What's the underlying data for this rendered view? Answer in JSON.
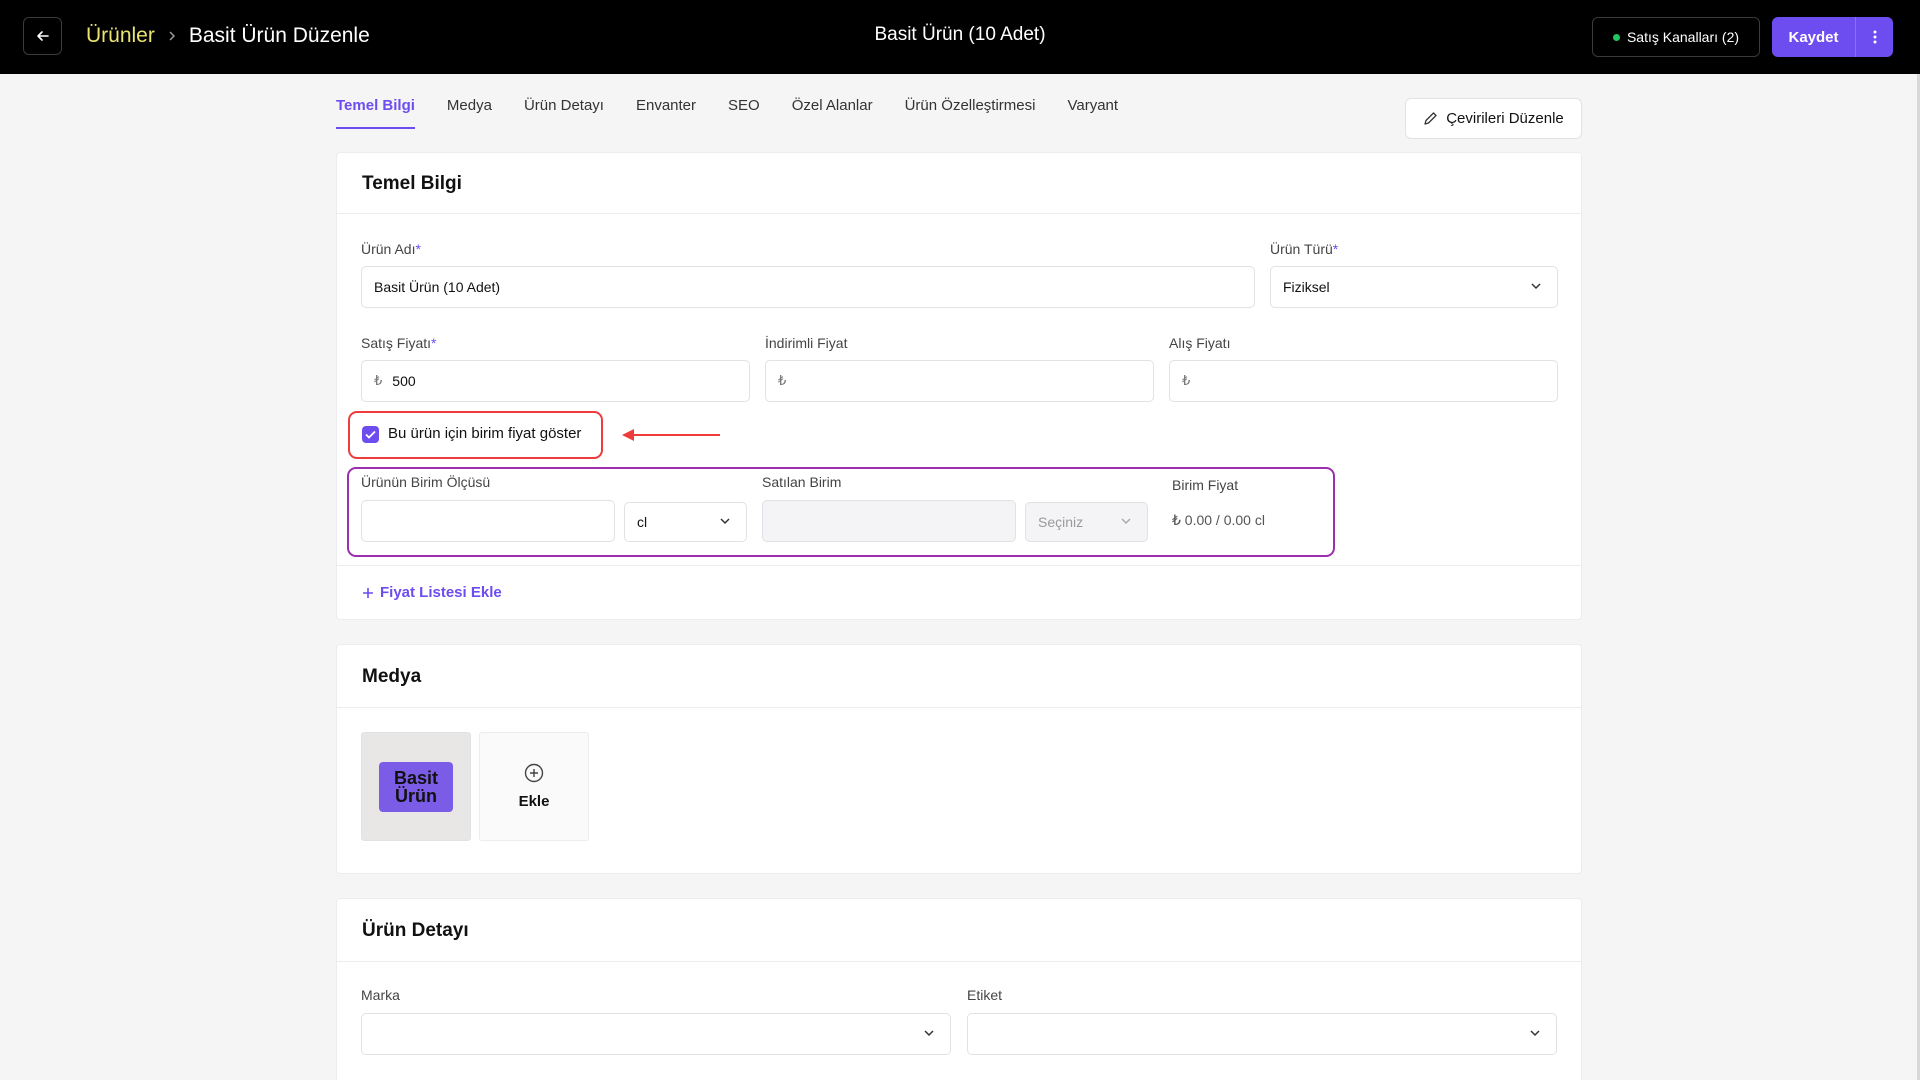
{
  "header": {
    "breadcrumb_root": "Ürünler",
    "breadcrumb_current": "Basit Ürün Düzenle",
    "center_title": "Basit Ürün (10 Adet)",
    "channels_label": "Satış Kanalları (2)",
    "save_label": "Kaydet"
  },
  "tabs": [
    "Temel Bilgi",
    "Medya",
    "Ürün Detayı",
    "Envanter",
    "SEO",
    "Özel Alanlar",
    "Ürün Özelleştirmesi",
    "Varyant"
  ],
  "translate_label": "Çevirileri Düzenle",
  "basic": {
    "title": "Temel Bilgi",
    "product_name_label": "Ürün Adı",
    "product_name_value": "Basit Ürün (10 Adet)",
    "product_type_label": "Ürün Türü",
    "product_type_value": "Fiziksel",
    "sale_price_label": "Satış Fiyatı",
    "sale_price_value": "500",
    "discount_price_label": "İndirimli Fiyat",
    "purchase_price_label": "Alış Fiyatı",
    "currency_symbol": "₺",
    "required_mark": "*",
    "unit_price_checkbox_label": "Bu ürün için birim fiyat göster",
    "unit_measure_label": "Ürünün Birim Ölçüsü",
    "unit_measure_unit": "cl",
    "sold_unit_label": "Satılan Birim",
    "sold_unit_placeholder": "Seçiniz",
    "unit_price_label": "Birim Fiyat",
    "unit_price_value": "₺ 0.00 / 0.00 cl",
    "add_price_list": "Fiyat Listesi Ekle"
  },
  "media": {
    "title": "Medya",
    "thumb_line1": "Basit",
    "thumb_line2": "Ürün",
    "add_label": "Ekle"
  },
  "detail": {
    "title": "Ürün Detayı",
    "brand_label": "Marka",
    "tag_label": "Etiket"
  },
  "colors": {
    "accent": "#6d4cf0",
    "annotation_red": "#ef3b3b",
    "annotation_purple": "#9b2fae",
    "breadcrumb_yellow": "#e8e373",
    "status_green": "#22c55e"
  },
  "icons": [
    "arrow-left-icon",
    "chevron-right-icon",
    "pencil-icon",
    "chevron-down-icon",
    "check-icon",
    "plus-icon",
    "plus-circle-icon",
    "more-vertical-icon"
  ]
}
